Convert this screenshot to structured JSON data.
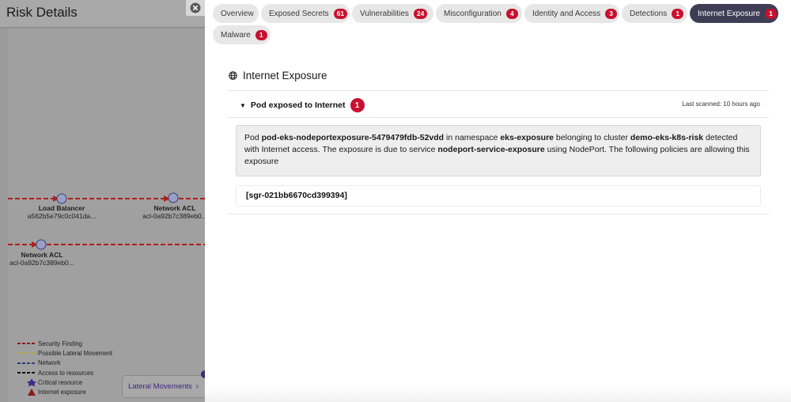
{
  "left": {
    "title": "Risk Details",
    "nodes": [
      {
        "name": "Load Balancer",
        "id": "a562b5e79c0c041da..."
      },
      {
        "name": "Network ACL",
        "id": "acl-0a92b7c389eb0..."
      },
      {
        "name": "Network ACL",
        "id": "acl-0a92b7c389eb0..."
      }
    ],
    "legend": [
      {
        "label": "Security Finding",
        "color": "#8b1a1a",
        "style": "dash"
      },
      {
        "label": "Possible Lateral Movement",
        "color": "#b2a24a",
        "style": "dash"
      },
      {
        "label": "Network",
        "color": "#2a3f7a",
        "style": "dash"
      },
      {
        "label": "Access to resources",
        "color": "#111111",
        "style": "dash"
      },
      {
        "label": "Critical resource",
        "color": "#3f2a88",
        "style": "star-icon"
      },
      {
        "label": "Internet exposure",
        "color": "#8b1a1a",
        "style": "warning-icon"
      }
    ],
    "lateral_button": "Lateral Movements"
  },
  "tabs": [
    {
      "label": "Overview",
      "count": null,
      "active": false
    },
    {
      "label": "Exposed Secrets",
      "count": "61",
      "active": false
    },
    {
      "label": "Vulnerabilities",
      "count": "24",
      "active": false
    },
    {
      "label": "Misconfiguration",
      "count": "4",
      "active": false
    },
    {
      "label": "Identity and Access",
      "count": "3",
      "active": false
    },
    {
      "label": "Detections",
      "count": "1",
      "active": false
    },
    {
      "label": "Internet Exposure",
      "count": "1",
      "active": true
    },
    {
      "label": "Malware",
      "count": "1",
      "active": false
    }
  ],
  "section": {
    "title": "Internet Exposure",
    "icon": "globe-icon"
  },
  "finding": {
    "title": "Pod exposed to Internet",
    "count": "1",
    "last_scanned": "Last scanned: 10 hours ago",
    "desc": {
      "t1": "Pod ",
      "pod": "pod-eks-nodeportexposure-5479479fdb-52vdd",
      "t2": " in namespace ",
      "namespace": "eks-exposure",
      "t3": " belonging to cluster ",
      "cluster": "demo-eks-k8s-risk",
      "t4": " detected with Internet access. The exposure is due to service ",
      "service": "nodeport-service-exposure",
      "t5": " using NodePort. The following policies are allowing this exposure"
    },
    "policy": "[sgr-021bb6670cd399394]"
  },
  "colors": {
    "accent_tab": "#3f3d56",
    "badge": "#c8102e"
  }
}
